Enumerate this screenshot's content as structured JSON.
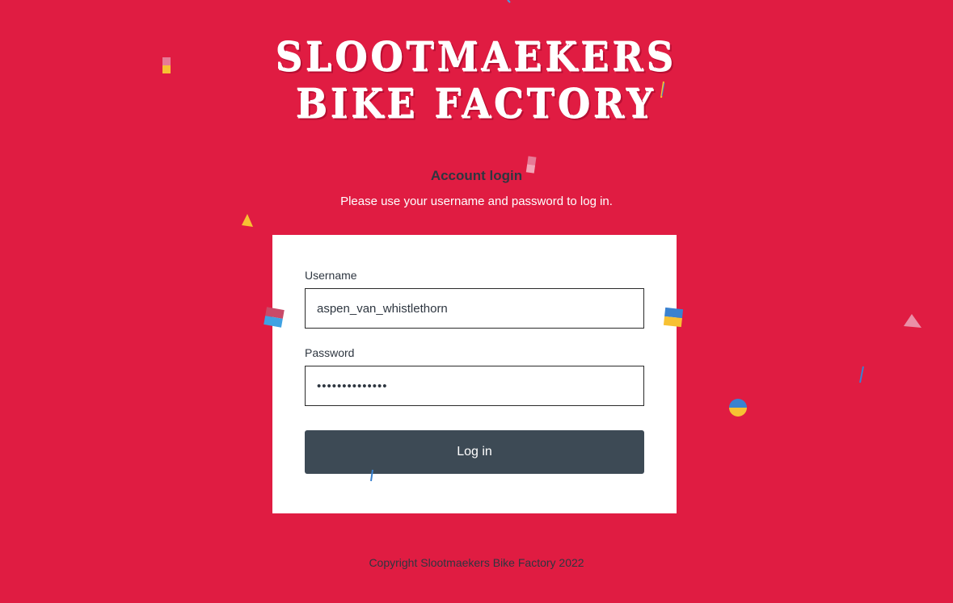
{
  "brand": {
    "line1": "SLOOTMAEKERS",
    "line2": "BIKE FACTORY"
  },
  "login": {
    "heading": "Account login",
    "subheading": "Please use your username and password to log in.",
    "username_label": "Username",
    "username_value": "aspen_van_whistlethorn",
    "password_label": "Password",
    "password_value": "••••••••••••••",
    "submit_label": "Log in"
  },
  "footer": {
    "copyright": "Copyright Slootmaekers Bike Factory 2022"
  },
  "colors": {
    "background": "#e01c42",
    "button": "#3d4a55",
    "text_dark": "#2e3640",
    "card": "#ffffff"
  },
  "confetti_icons": [
    "confetti-square-icon",
    "confetti-triangle-icon",
    "confetti-circle-icon",
    "confetti-streamer-icon"
  ]
}
